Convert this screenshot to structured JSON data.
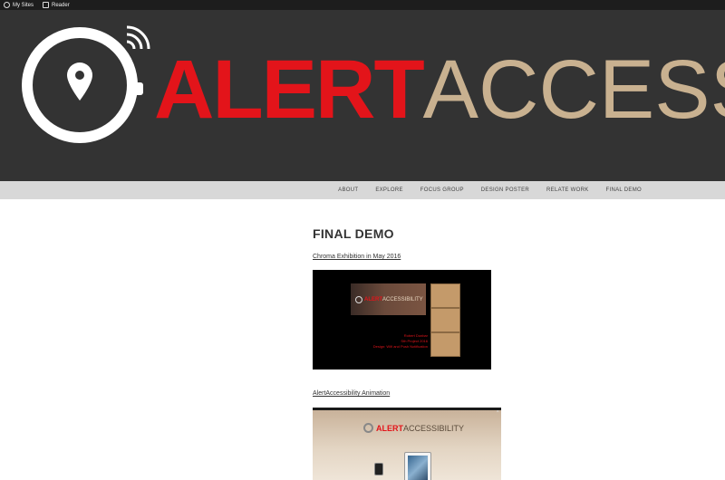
{
  "adminbar": {
    "my_sites": "My Sites",
    "reader": "Reader"
  },
  "header": {
    "brand_alert": "ALERT",
    "brand_access": "ACCESS"
  },
  "nav": {
    "items": [
      "ABOUT",
      "EXPLORE",
      "FOCUS GROUP",
      "DESIGN POSTER",
      "RELATE WORK",
      "FINAL DEMO"
    ]
  },
  "main": {
    "title": "FINAL DEMO",
    "link1": "Chroma Exhibition in May 2016",
    "link2": "AlertAccessibility Animation",
    "video1": {
      "brand_alert": "ALERT",
      "brand_access": "ACCESSIBILITY",
      "credits": [
        "Robert Dunbar",
        "Sth Project 2016",
        "Design: Wifi and Push Notification"
      ]
    },
    "video2": {
      "brand_alert": "ALERT",
      "brand_access": "ACCESSIBILITY",
      "close": "×"
    }
  },
  "colors": {
    "brand_red": "#e3141a",
    "brand_tan": "#c9b190",
    "header_bg": "#333333"
  }
}
